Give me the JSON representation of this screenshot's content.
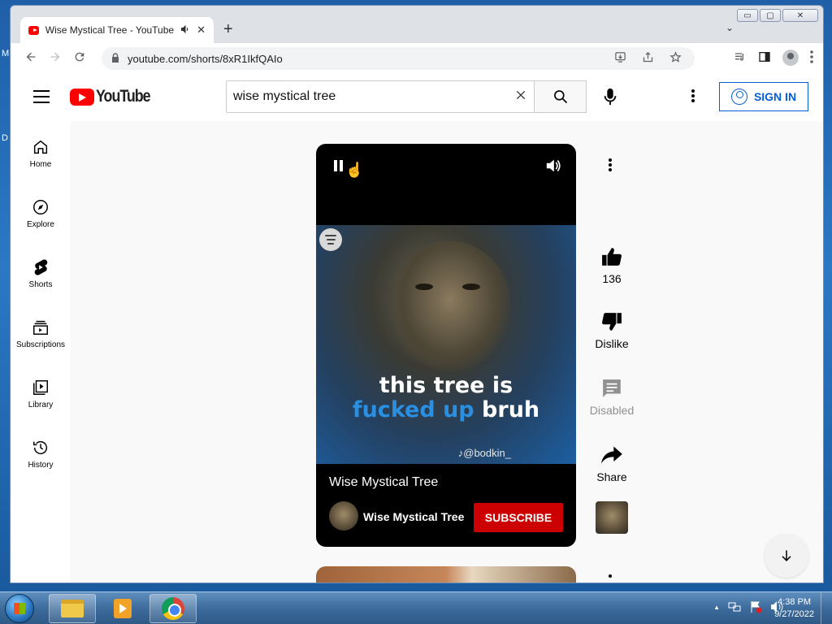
{
  "desktop": {
    "edge_letters": [
      "M",
      "D"
    ]
  },
  "browser": {
    "window_controls": {
      "minimize": "▭",
      "maximize": "▢",
      "close": "✕"
    },
    "tab": {
      "title": "Wise Mystical Tree - YouTube",
      "audio_icon": "speaker-icon",
      "close": "✕"
    },
    "new_tab": "+",
    "tab_dropdown": "⌄",
    "url": "youtube.com/shorts/8xR1IkfQAIo"
  },
  "youtube": {
    "search": {
      "value": "wise mystical tree",
      "placeholder": "Search"
    },
    "sign_in_label": "SIGN IN",
    "sidebar": [
      {
        "label": "Home",
        "icon": "home-icon"
      },
      {
        "label": "Explore",
        "icon": "compass-icon"
      },
      {
        "label": "Shorts",
        "icon": "shorts-icon"
      },
      {
        "label": "Subscriptions",
        "icon": "subscriptions-icon"
      },
      {
        "label": "Library",
        "icon": "library-icon"
      },
      {
        "label": "History",
        "icon": "history-icon"
      }
    ],
    "short": {
      "caption_line1": "this tree is",
      "caption_line2_blue": "fucked up",
      "caption_line2_white": "bruh",
      "watermark": "@bodkin_",
      "title": "Wise Mystical Tree",
      "channel": "Wise Mystical Tree",
      "subscribe_label": "SUBSCRIBE"
    },
    "actions": {
      "like_count": "136",
      "dislike_label": "Dislike",
      "comments_label": "Disabled",
      "share_label": "Share"
    }
  },
  "taskbar": {
    "time": "4:38 PM",
    "date": "9/27/2022",
    "tray_arrow": "▲"
  },
  "colors": {
    "youtube_red": "#ff0000",
    "subscribe_red": "#cc0000",
    "link_blue": "#065fd4"
  }
}
